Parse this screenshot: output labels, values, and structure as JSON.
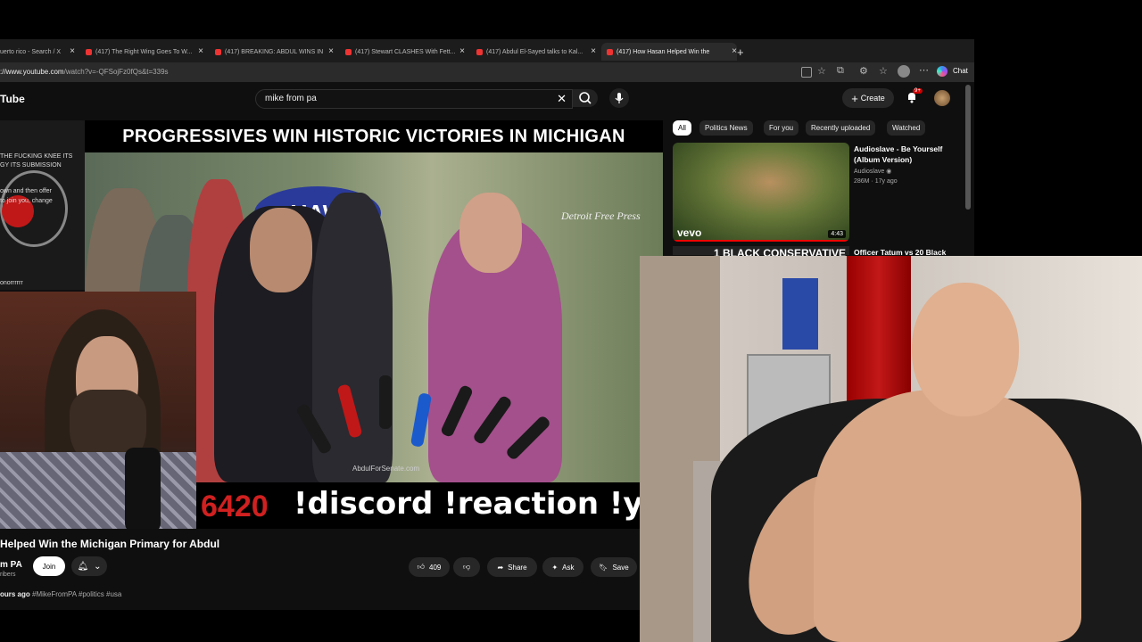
{
  "browser": {
    "tabs": [
      {
        "label": "uerto rico - Search / X",
        "active": false
      },
      {
        "label": "(417) The Right Wing Goes To W...",
        "active": false
      },
      {
        "label": "(417) BREAKING: ABDUL WINS IN",
        "active": false
      },
      {
        "label": "(417) Stewart CLASHES With Fett...",
        "active": false
      },
      {
        "label": "(417) Abdul El-Sayed talks to Kal...",
        "active": false
      },
      {
        "label": "(417) How Hasan Helped Win the",
        "active": true
      }
    ],
    "new_tab": "+",
    "url_host": "://www.youtube.com",
    "url_path": "/watch?v=-QFSojFz0fQs&t=339s",
    "chat_label": "Chat",
    "window_min": "─",
    "window_max": "□",
    "window_close": "✕"
  },
  "youtube": {
    "logo": "Tube",
    "search_value": "mike from pa",
    "create_label": "Create",
    "notif_badge": "9+",
    "chips": [
      "All",
      "Politics News",
      "For you",
      "Recently uploaded",
      "Watched"
    ]
  },
  "video": {
    "overlay_title": "PROGRESSIVES WIN HISTORIC VICTORIES IN MICHIGAN",
    "uaw": "UAW",
    "watermark": "Detroit Free Press",
    "ticker_num": "6420",
    "ticker_cmd": "!discord !reaction !youtube",
    "podium": "AbdulForSenate.com"
  },
  "chat_overlay": {
    "line1": "THE FUCKING KNEE ITS",
    "line2": "GY ITS SUBMISSION",
    "line3": "own and then offer",
    "line4": "to join you, change",
    "user": "onorrrrrr"
  },
  "video_info": {
    "title": "Helped Win the Michigan Primary for Abdul",
    "channel": "m PA",
    "subs": "ribers",
    "join": "Join",
    "likes": "409",
    "share": "Share",
    "ask": "Ask",
    "save": "Save",
    "time": "ours ago",
    "tags": "#MikeFromPA #politics #usa"
  },
  "recommendation": {
    "title": "Audioslave - Be Yourself (Album Version)",
    "channel": "Audioslave",
    "meta": "286M · 17y ago",
    "duration": "4:43",
    "vevo": "vevo",
    "next_thumb_text": "1 BLACK CONSERVATIVE",
    "next_title": "Officer Tatum vs 20 Black"
  }
}
